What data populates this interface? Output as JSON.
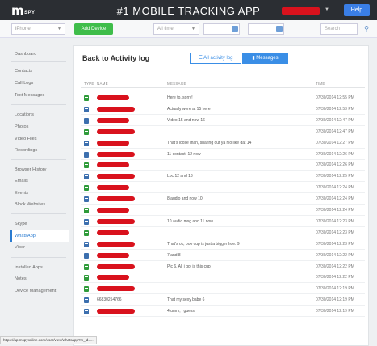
{
  "header": {
    "tagline": "",
    "logo_letter": "m",
    "logo_word": "SPY",
    "app_title": "#1 MOBILE TRACKING APP",
    "help_label": "Help"
  },
  "filters": {
    "device": "iPhone",
    "add_device_label": "Add Device",
    "time": "All time",
    "date_from": "",
    "date_to": "",
    "date_sep": "—",
    "search_placeholder": "Search"
  },
  "sidebar": {
    "items": [
      {
        "label": "Dashboard"
      },
      {
        "label": "Contacts"
      },
      {
        "label": "Call Logs"
      },
      {
        "label": "Text Messages"
      },
      {
        "label": "Locations"
      },
      {
        "label": "Photos"
      },
      {
        "label": "Video Files"
      },
      {
        "label": "Recordings"
      },
      {
        "label": "Browser History"
      },
      {
        "label": "Emails"
      },
      {
        "label": "Events"
      },
      {
        "label": "Block Websites"
      },
      {
        "label": "Skype"
      },
      {
        "label": "WhatsApp"
      },
      {
        "label": "Viber"
      },
      {
        "label": "Installed Apps"
      },
      {
        "label": "Notes"
      },
      {
        "label": "Device Management"
      }
    ],
    "active": "WhatsApp"
  },
  "panel": {
    "title": "Back to Activity log",
    "all_activity_label": "All activity log",
    "messages_label": "Messages",
    "columns": {
      "type": "TYPE",
      "name": "NAME",
      "message": "MESSAGE",
      "time": "TIME"
    }
  },
  "rows": [
    {
      "type": "in",
      "name": "",
      "message": "Here to, sorry!",
      "time": "07/30/2014 12:55 PM"
    },
    {
      "type": "out",
      "name": "",
      "message": "Actually were at 15 here",
      "time": "07/30/2014 12:53 PM"
    },
    {
      "type": "out",
      "name": "",
      "message": "Video 15 and now 16",
      "time": "07/30/2014 12:47 PM"
    },
    {
      "type": "in",
      "name": "",
      "message": "",
      "time": "07/30/2014 12:47 PM"
    },
    {
      "type": "out",
      "name": "",
      "message": "That's loose man, sharing out ya hio like dat 14",
      "time": "07/30/2014 12:27 PM"
    },
    {
      "type": "out",
      "name": "",
      "message": "11 contact, 12 now",
      "time": "07/30/2014 12:26 PM"
    },
    {
      "type": "in",
      "name": "",
      "message": "",
      "time": "07/30/2014 12:26 PM"
    },
    {
      "type": "out",
      "name": "",
      "message": "Loc 12 and 13",
      "time": "07/30/2014 12:25 PM"
    },
    {
      "type": "in",
      "name": "",
      "message": "",
      "time": "07/30/2014 12:24 PM"
    },
    {
      "type": "out",
      "name": "",
      "message": "8 audio and now 10",
      "time": "07/30/2014 12:24 PM"
    },
    {
      "type": "in",
      "name": "",
      "message": "",
      "time": "07/30/2014 12:24 PM"
    },
    {
      "type": "out",
      "name": "",
      "message": "10 audio msg and 11 now",
      "time": "07/30/2014 12:23 PM"
    },
    {
      "type": "in",
      "name": "",
      "message": "",
      "time": "07/30/2014 12:23 PM"
    },
    {
      "type": "out",
      "name": "",
      "message": "That's ok, poo cup is just a bigger hoe. 9",
      "time": "07/30/2014 12:23 PM"
    },
    {
      "type": "out",
      "name": "",
      "message": "7 and 8",
      "time": "07/30/2014 12:22 PM"
    },
    {
      "type": "in",
      "name": "",
      "message": "Pic 6. All i got is this cup",
      "time": "07/30/2014 12:22 PM"
    },
    {
      "type": "in",
      "name": "",
      "message": "",
      "time": "07/30/2014 12:22 PM"
    },
    {
      "type": "in",
      "name": "",
      "message": "",
      "time": "07/30/2014 12:19 PM"
    },
    {
      "type": "out",
      "name": "66830254766",
      "message": "That my sexy babe 6",
      "time": "07/30/2014 12:19 PM"
    },
    {
      "type": "out",
      "name": "",
      "message": "4 umm, i guess",
      "time": "07/30/2014 12:19 PM"
    }
  ],
  "status_url": "https://ap.mspyonline.com/user/view/whatsapp?m_id=..."
}
